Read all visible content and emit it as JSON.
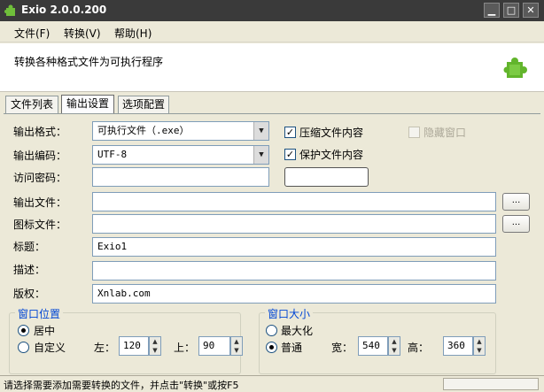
{
  "window": {
    "title": "Exio 2.0.0.200",
    "controls": [
      "minimize",
      "maximize",
      "close"
    ]
  },
  "menu": {
    "items": [
      "文件(F)",
      "转换(V)",
      "帮助(H)"
    ]
  },
  "banner": {
    "description": "转换各种格式文件为可执行程序",
    "icon": "puzzle-icon"
  },
  "tabs": [
    {
      "label": "文件列表",
      "active": false
    },
    {
      "label": "输出设置",
      "active": true
    },
    {
      "label": "选项配置",
      "active": false
    }
  ],
  "form": {
    "output_format_label": "输出格式：",
    "output_format_value": "可执行文件（.exe）",
    "output_encoding_label": "输出编码：",
    "output_encoding_value": "UTF-8",
    "password_label": "访问密码：",
    "password_value": "",
    "output_file_label": "输出文件：",
    "output_file_value": "",
    "icon_file_label": "图标文件：",
    "icon_file_value": "",
    "title_label": "标题：",
    "title_value": "Exio1",
    "desc_label": "描述：",
    "desc_value": "",
    "copyright_label": "版权：",
    "copyright_value": "Xnlab.com",
    "browse_label": "...",
    "compress_label": "压缩文件内容",
    "compress_checked": true,
    "protect_label": "保护文件内容",
    "protect_checked": true,
    "hide_window_label": "隐藏窗口",
    "hide_window_checked": false
  },
  "window_position": {
    "title": "窗口位置",
    "center_label": "居中",
    "center_selected": true,
    "custom_label": "自定义",
    "custom_selected": false,
    "left_label": "左：",
    "left_value": "120",
    "top_label": "上：",
    "top_value": "90"
  },
  "window_size": {
    "title": "窗口大小",
    "max_label": "最大化",
    "max_selected": false,
    "normal_label": "普通",
    "normal_selected": true,
    "width_label": "宽：",
    "width_value": "540",
    "height_label": "高：",
    "height_value": "360"
  },
  "status": {
    "text": "请选择需要添加需要转换的文件，并点击\"转换\"或按F5"
  }
}
